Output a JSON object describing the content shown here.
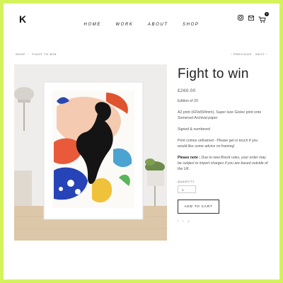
{
  "brand": {
    "logo": "K"
  },
  "nav": {
    "items": [
      "HOME",
      "WORK",
      "ABOUT",
      "SHOP"
    ]
  },
  "header_icons": [
    "instagram-icon",
    "mail-icon",
    "cart-icon"
  ],
  "cart": {
    "count": "0"
  },
  "breadcrumb": {
    "items": [
      "SHOP",
      "FIGHT TO WIN"
    ]
  },
  "pager": {
    "previous": "‹ PREVIOUS",
    "next": "NEXT ›"
  },
  "product": {
    "title": "Fight to win",
    "price": "£260.00",
    "edition": "Edition of 20",
    "spec": "A2 print (420x594mm), Super luxe Giclee print onto Somerset Archival paper",
    "signed": "Signed & numbered",
    "frame_note": "Print comes unframed - Please get in touch if you would like some advice on framing!",
    "note_label": "Please note :",
    "note_text": "Due to new Brexit rules, your order may be subject to import charges if you are based outside of the UK.",
    "quantity_label": "QUANTITY",
    "quantity_value": "1",
    "add_to_cart": "ADD TO CART"
  },
  "share": [
    "f",
    "t",
    "p"
  ],
  "colors": {
    "frame_border": "#d4f25a",
    "text": "#222222"
  }
}
